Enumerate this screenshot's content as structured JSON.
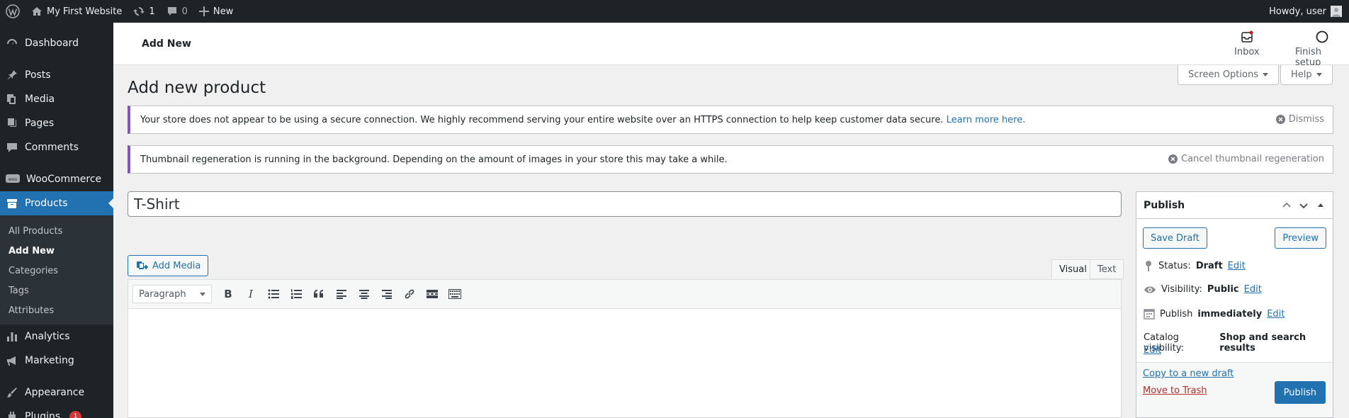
{
  "adminbar": {
    "site_name": "My First Website",
    "updates_count": "1",
    "comments_count": "0",
    "new_label": "New",
    "howdy": "Howdy, user"
  },
  "sidebar": {
    "items": [
      {
        "label": "Dashboard",
        "icon": "dashboard-icon"
      },
      {
        "label": "Posts",
        "icon": "pin-icon"
      },
      {
        "label": "Media",
        "icon": "media-icon"
      },
      {
        "label": "Pages",
        "icon": "pages-icon"
      },
      {
        "label": "Comments",
        "icon": "comments-icon"
      },
      {
        "label": "WooCommerce",
        "icon": "woo-icon"
      },
      {
        "label": "Products",
        "icon": "archive-icon"
      },
      {
        "label": "Analytics",
        "icon": "analytics-icon"
      },
      {
        "label": "Marketing",
        "icon": "megaphone-icon"
      },
      {
        "label": "Appearance",
        "icon": "brush-icon"
      },
      {
        "label": "Plugins",
        "icon": "plugin-icon",
        "badge": "1"
      }
    ],
    "submenu": [
      "All Products",
      "Add New",
      "Categories",
      "Tags",
      "Attributes"
    ]
  },
  "header": {
    "title": "Add New",
    "inbox_label": "Inbox",
    "finish_setup_label": "Finish setup"
  },
  "screen_options_label": "Screen Options",
  "help_label": "Help",
  "page_title": "Add new product",
  "notices": {
    "https_text": "Your store does not appear to be using a secure connection. We highly recommend serving your entire website over an HTTPS connection to help keep customer data secure. ",
    "https_link": "Learn more here.",
    "dismiss": "Dismiss",
    "thumb_text": "Thumbnail regeneration is running in the background. Depending on the amount of images in your store this may take a while.",
    "cancel_regen": "Cancel thumbnail regeneration"
  },
  "product_title": "T-Shirt",
  "editor": {
    "add_media": "Add Media",
    "tab_visual": "Visual",
    "tab_text": "Text",
    "format": "Paragraph"
  },
  "publish": {
    "heading": "Publish",
    "save_draft": "Save Draft",
    "preview": "Preview",
    "status_label": "Status:",
    "status_value": "Draft",
    "visibility_label": "Visibility:",
    "visibility_value": "Public",
    "publish_label": "Publish",
    "publish_value": "immediately",
    "catalog_label": "Catalog visibility:",
    "catalog_value": "Shop and search results",
    "edit": "Edit",
    "copy_draft": "Copy to a new draft",
    "trash": "Move to Trash",
    "publish_button": "Publish"
  },
  "colors": {
    "accent": "#2271b1",
    "adminbar": "#1d2327",
    "trash": "#b32d2e"
  }
}
